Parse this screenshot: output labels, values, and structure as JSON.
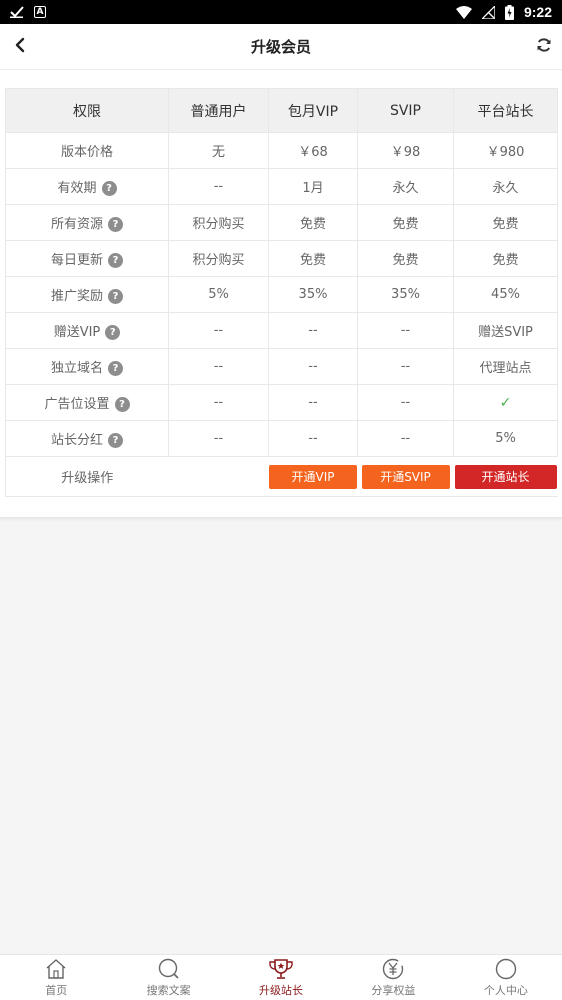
{
  "status_bar": {
    "time": "9:22",
    "left_icons": [
      "checkmark-icon",
      "a-notification-icon"
    ],
    "right_icons": [
      "wifi-icon",
      "no-signal-icon",
      "battery-charging-icon"
    ]
  },
  "header": {
    "title": "升级会员",
    "back_icon": "chevron-left-icon",
    "refresh_icon": "refresh-icon"
  },
  "table": {
    "headers": [
      "权限",
      "普通用户",
      "包月VIP",
      "SVIP",
      "平台站长"
    ],
    "rows": [
      {
        "label": "版本价格",
        "help": false,
        "cells": [
          "无",
          "￥68",
          "￥98",
          "￥980"
        ]
      },
      {
        "label": "有效期",
        "help": true,
        "cells": [
          "--",
          "1月",
          "永久",
          "永久"
        ]
      },
      {
        "label": "所有资源",
        "help": true,
        "cells": [
          "积分购买",
          "免费",
          "免费",
          "免费"
        ]
      },
      {
        "label": "每日更新",
        "help": true,
        "cells": [
          "积分购买",
          "免费",
          "免费",
          "免费"
        ]
      },
      {
        "label": "推广奖励",
        "help": true,
        "cells": [
          "5%",
          "35%",
          "35%",
          "45%"
        ]
      },
      {
        "label": "赠送VIP",
        "help": true,
        "cells": [
          "--",
          "--",
          "--",
          "赠送SVIP"
        ]
      },
      {
        "label": "独立域名",
        "help": true,
        "cells": [
          "--",
          "--",
          "--",
          "代理站点"
        ]
      },
      {
        "label": "广告位设置",
        "help": true,
        "cells": [
          "--",
          "--",
          "--",
          "✓"
        ]
      },
      {
        "label": "站长分红",
        "help": true,
        "cells": [
          "--",
          "--",
          "--",
          "5%"
        ]
      }
    ],
    "help_symbol": "?",
    "action_row": {
      "label": "升级操作",
      "buttons": [
        "开通VIP",
        "开通SVIP",
        "开通站长"
      ]
    }
  },
  "colors": {
    "price": "#e53935",
    "button_orange": "#f5641e",
    "button_red": "#d32626",
    "checkmark": "#4caf50",
    "nav_active": "#8b1a1a"
  },
  "bottom_nav": {
    "items": [
      {
        "label": "首页",
        "icon": "home-icon"
      },
      {
        "label": "搜索文案",
        "icon": "search-icon"
      },
      {
        "label": "升级站长",
        "icon": "trophy-icon",
        "active": true
      },
      {
        "label": "分享权益",
        "icon": "yen-share-icon"
      },
      {
        "label": "个人中心",
        "icon": "user-circle-icon"
      }
    ]
  }
}
